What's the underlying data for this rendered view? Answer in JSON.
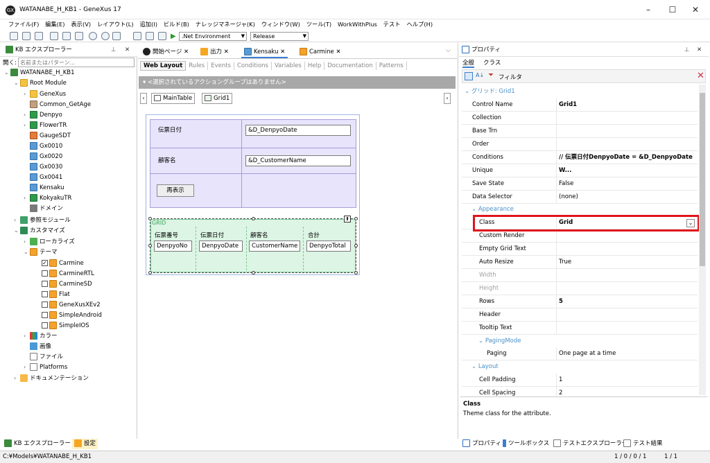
{
  "window": {
    "title": "WATANABE_H_KB1 - GeneXus 17",
    "app_icon": "GX"
  },
  "menu": [
    "ファイル(F)",
    "編集(E)",
    "表示(V)",
    "レイアウト(L)",
    "追加(I)",
    "ビルド(B)",
    "ナレッジマネージャ(K)",
    "ウィンドウ(W)",
    "ツール(T)",
    "WorkWithPlus",
    "テスト",
    "ヘルプ(H)"
  ],
  "toolbar": {
    "environment": ".Net Environment",
    "config": "Release"
  },
  "kb_explorer": {
    "title": "KB エクスプローラー",
    "search_placeholder": "名前またはパターン...",
    "search_label": "開く:",
    "root": "WATANABE_H_KB1",
    "root_module": "Root Module",
    "items": [
      "GeneXus",
      "Common_GetAge",
      "Denpyo",
      "FlowerTR",
      "GaugeSDT",
      "Gx0010",
      "Gx0020",
      "Gx0030",
      "Gx0041",
      "Kensaku",
      "KokyakuTR",
      "ドメイン"
    ],
    "ref_module": "参照モジュール",
    "customize": "カスタマイズ",
    "localize": "ローカライズ",
    "theme": "テーマ",
    "themes": [
      "Carmine",
      "CarmineRTL",
      "CarmineSD",
      "Flat",
      "GeneXusXEv2",
      "SimpleAndroid",
      "SimpleIOS"
    ],
    "others": [
      "カラー",
      "画像",
      "ファイル",
      "Platforms"
    ],
    "documentation": "ドキュメンテーション",
    "bottom_tabs": [
      "KB エクスプローラー",
      "設定"
    ]
  },
  "editor": {
    "tabs": [
      "開始ページ",
      "出力",
      "Kensaku",
      "Carmine"
    ],
    "active_tab": "Kensaku",
    "subtabs": [
      "Web Layout",
      "Rules",
      "Events",
      "Conditions",
      "Variables",
      "Help",
      "Documentation",
      "Patterns"
    ],
    "action_group": "<選択されているアクショングループはありません>",
    "breadcrumb": [
      "MainTable",
      "Grid1"
    ],
    "form": {
      "label1": "伝票日付",
      "field1": "&D_DenpyoDate",
      "label2": "顧客名",
      "field2": "&D_CustomerName",
      "button": "再表示"
    },
    "grid": {
      "label": "GRID",
      "headers": [
        "伝票番号",
        "伝票日付",
        "顧客名",
        "合計"
      ],
      "cells": [
        "DenpyoNo",
        "DenpyoDate",
        "CustomerName",
        "DenpyoTotal"
      ]
    }
  },
  "properties": {
    "title": "プロパティ",
    "tabs": [
      "全般",
      "クラス"
    ],
    "filter_label": "フィルタ",
    "group": "グリッド: Grid1",
    "rows1": [
      {
        "k": "Control Name",
        "v": "Grid1",
        "bold": true
      },
      {
        "k": "Collection",
        "v": ""
      },
      {
        "k": "Base Trn",
        "v": ""
      },
      {
        "k": "Order",
        "v": ""
      },
      {
        "k": "Conditions",
        "v": "// 伝票日付DenpyoDate = &D_DenpyoDate W...",
        "bold": true
      },
      {
        "k": "Unique",
        "v": ""
      },
      {
        "k": "Save State",
        "v": "False"
      },
      {
        "k": "Data Selector",
        "v": "(none)"
      }
    ],
    "appearance": "Appearance",
    "rows2": [
      {
        "k": "Class",
        "v": "Grid",
        "bold": true
      },
      {
        "k": "Custom Render",
        "v": ""
      },
      {
        "k": "Empty Grid Text",
        "v": ""
      },
      {
        "k": "Auto Resize",
        "v": "True"
      },
      {
        "k": "Width",
        "v": "",
        "gray": true
      },
      {
        "k": "Height",
        "v": "",
        "gray": true
      },
      {
        "k": "Rows",
        "v": "5",
        "bold": true
      },
      {
        "k": "Header",
        "v": ""
      },
      {
        "k": "Tooltip Text",
        "v": ""
      }
    ],
    "paging_mode": "PagingMode",
    "paging": {
      "k": "Paging",
      "v": "One page at a time"
    },
    "layout": "Layout",
    "rows3": [
      {
        "k": "Cell Padding",
        "v": "1"
      },
      {
        "k": "Cell Spacing",
        "v": "2"
      }
    ],
    "help_title": "Class",
    "help_text": "Theme class for the attribute.",
    "bottom_tabs": [
      "プロパティ",
      "ツールボックス",
      "テストエクスプローラー",
      "テスト結果"
    ]
  },
  "status": {
    "path": "C:¥Models¥WATANABE_H_KB1",
    "pos": "1 / 0 / 0 / 1",
    "count": "1 / 1"
  },
  "colors": {
    "accent": "#4a90c8",
    "highlight": "#e0141b",
    "layout_purple": "#e8e4fb",
    "grid_green": "#dcf5e4"
  }
}
